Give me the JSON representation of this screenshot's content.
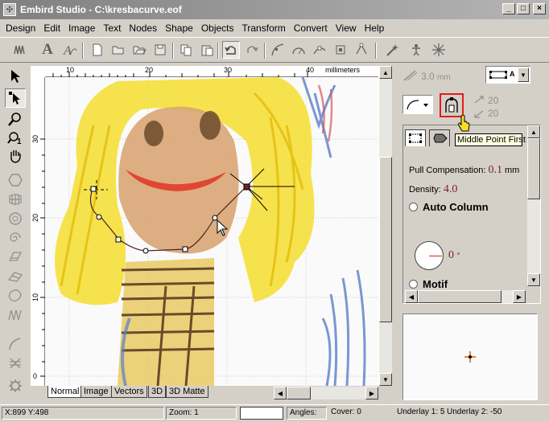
{
  "window": {
    "title": "Embird Studio - C:\\kresbacurve.eof"
  },
  "menu": [
    "Design",
    "Edit",
    "Image",
    "Text",
    "Nodes",
    "Shape",
    "Objects",
    "Transform",
    "Convert",
    "View",
    "Help"
  ],
  "ruler": {
    "unit": "millimeters",
    "top_ticks": [
      "10",
      "20",
      "30",
      "40"
    ],
    "left_ticks": [
      "30",
      "20",
      "10",
      "0"
    ]
  },
  "view_tabs": [
    {
      "label": "Normal",
      "active": true
    },
    {
      "label": "Image",
      "active": false
    },
    {
      "label": "Vectors",
      "active": false
    },
    {
      "label": "3D",
      "active": false
    },
    {
      "label": "3D Matte",
      "active": false
    }
  ],
  "right_panel": {
    "thread_width": "3.0",
    "thread_unit": "mm",
    "combo_label": "A",
    "spacing_top": "20",
    "spacing_bottom": "20",
    "tooltip": "Middle Point First",
    "pull_comp_label": "Pull Compensation:",
    "pull_comp_value": "0.1",
    "pull_comp_unit": "mm",
    "density_label": "Density:",
    "density_value": "4.0",
    "auto_column_label": "Auto Column",
    "angle_value": "0",
    "angle_unit": "°",
    "motif_label": "Motif"
  },
  "status": {
    "coords": "X:899  Y:498",
    "zoom": "Zoom: 1",
    "angles": "Angles:",
    "cover": "Cover: 0",
    "underlay1": "Underlay 1: 50",
    "underlay2": "Underlay 2: -50"
  },
  "colors": {
    "highlight": "#e21b1b",
    "value_text": "#7a1f1f",
    "tooltip_bg": "#ffffe1",
    "hair": "#f5dd2e",
    "face": "#d8a574"
  },
  "icons": {
    "toolbar": [
      "satin-stitch-icon",
      "text-icon",
      "art-text-icon",
      "new-icon",
      "open-icon",
      "open-folder-icon",
      "save-icon",
      "copy-icon",
      "paste-icon",
      "undo-icon",
      "redo-icon",
      "curve-icon",
      "measure-icon",
      "node-add-icon",
      "node-move-icon",
      "node-convert-icon",
      "node-delete-icon",
      "wand-icon",
      "puppet-icon",
      "star-tool-icon"
    ]
  }
}
